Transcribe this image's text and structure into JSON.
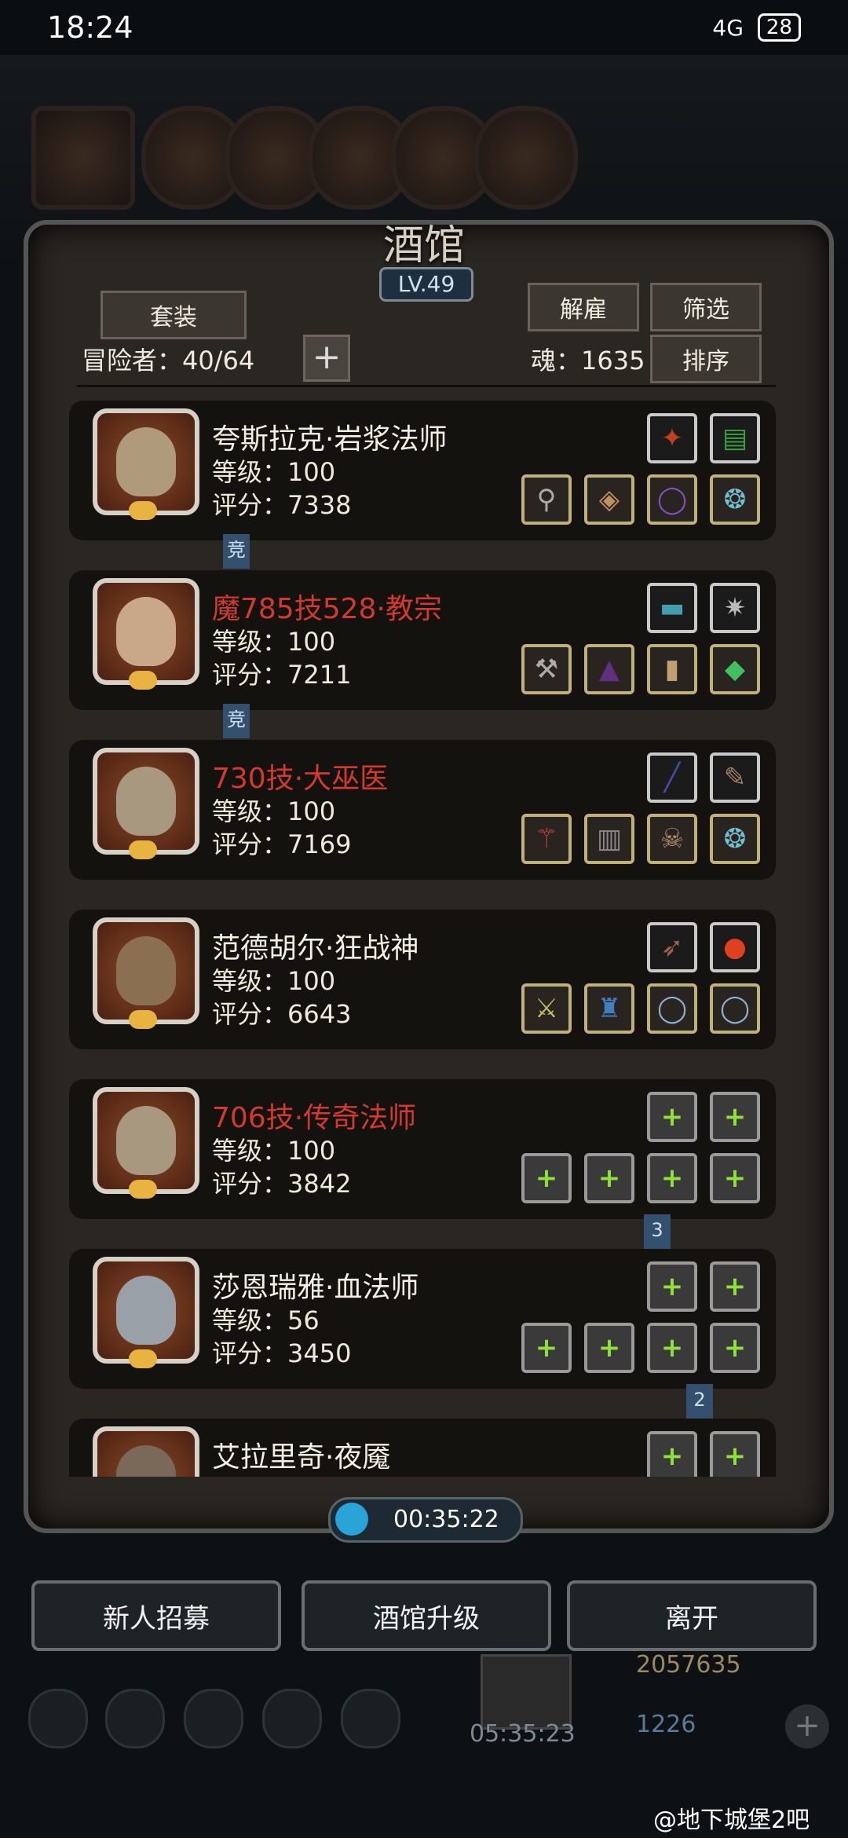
{
  "status_bar": {
    "time": "18:24",
    "battery": "28",
    "signal": "4G"
  },
  "tavern": {
    "title": "酒馆",
    "level": "LV.49",
    "set_button": "套装",
    "dismiss_button": "解雇",
    "filter_button": "筛选",
    "sort_button": "排序",
    "adventurers": "冒险者：40/64",
    "souls": "魂：1635"
  },
  "heroes": [
    {
      "name": "夸斯拉克·岩浆法师",
      "name_color": "white",
      "level": "等级：100",
      "score": "评分：7338",
      "tag": "竞",
      "gear_filled": true
    },
    {
      "name": "魔785技528·教宗",
      "name_color": "red",
      "level": "等级：100",
      "score": "评分：7211",
      "tag": "竞",
      "gear_filled": true
    },
    {
      "name": "730技·大巫医",
      "name_color": "red",
      "level": "等级：100",
      "score": "评分：7169",
      "tag": "",
      "gear_filled": true
    },
    {
      "name": "范德胡尔·狂战神",
      "name_color": "white",
      "level": "等级：100",
      "score": "评分：6643",
      "tag": "",
      "gear_filled": true
    },
    {
      "name": "706技·传奇法师",
      "name_color": "red",
      "level": "等级：100",
      "score": "评分：3842",
      "tag": "3",
      "gear_filled": false
    },
    {
      "name": "莎恩瑞雅·血法师",
      "name_color": "white",
      "level": "等级：56",
      "score": "评分：3450",
      "tag": "2",
      "gear_filled": false
    },
    {
      "name": "艾拉里奇·夜魇",
      "name_color": "white",
      "level": "",
      "score": "",
      "tag": "",
      "gear_filled": false
    }
  ],
  "timer": "00:35:22",
  "actions": {
    "recruit": "新人招募",
    "upgrade": "酒馆升级",
    "leave": "离开"
  },
  "resources": {
    "gold": "2057635",
    "gems": "1226",
    "gift_timer": "05:35:23"
  },
  "watermark": "@地下城堡2吧"
}
